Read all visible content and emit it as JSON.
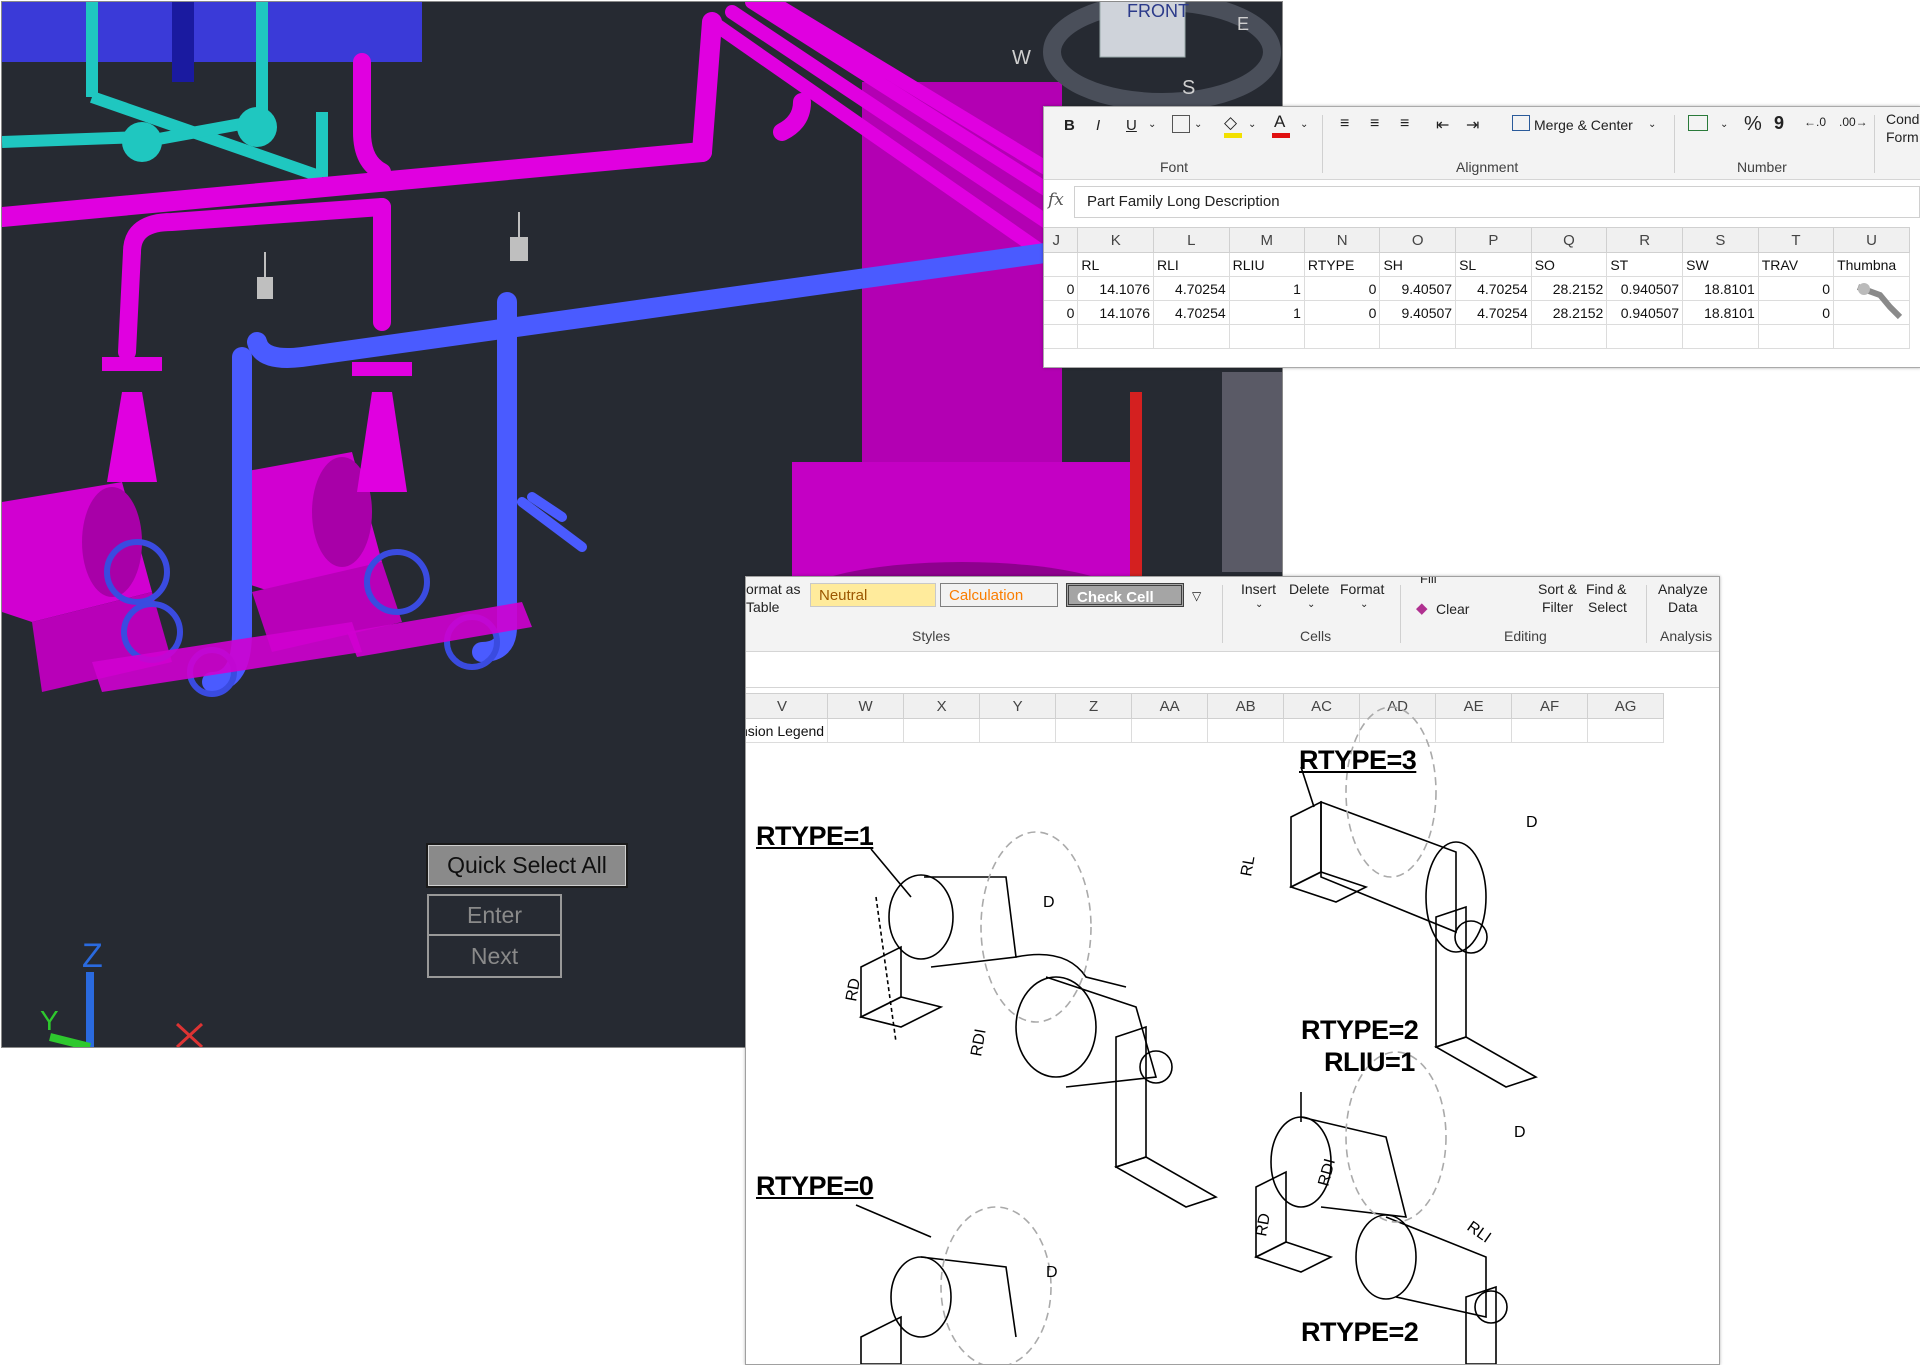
{
  "cad": {
    "view_cube": {
      "face": "FRONT",
      "compass_w": "W",
      "compass_s": "S",
      "compass_e": "E"
    },
    "ucs": {
      "z": "Z",
      "y": "Y"
    },
    "quick_select_button": "Quick Select All",
    "context_menu": [
      "Enter",
      "Next"
    ],
    "colors": {
      "background": "#262a32",
      "pipe": "#e000e0",
      "selected": "#4a5bff",
      "cyan": "#1fc7c0"
    }
  },
  "excel_top": {
    "ribbon": {
      "font_buttons": [
        "B",
        "I",
        "U"
      ],
      "merge_center": "Merge & Center",
      "percent": "%",
      "comma": "9",
      "conditional_1": "Cond",
      "conditional_2": "Form",
      "groups": {
        "font": "Font",
        "alignment": "Alignment",
        "number": "Number"
      }
    },
    "formula_bar": {
      "fx": "fx",
      "value": "Part Family Long Description"
    },
    "column_headers": [
      "J",
      "K",
      "L",
      "M",
      "N",
      "O",
      "P",
      "Q",
      "R",
      "S",
      "T",
      "U"
    ],
    "field_row": [
      "",
      "RL",
      "RLI",
      "RLIU",
      "RTYPE",
      "SH",
      "SL",
      "SO",
      "ST",
      "SW",
      "TRAV",
      "Thumbna"
    ],
    "rows": [
      [
        "0",
        "14.1076",
        "4.70254",
        "1",
        "0",
        "9.40507",
        "4.70254",
        "28.2152",
        "0.940507",
        "18.8101",
        "0",
        ""
      ],
      [
        "0",
        "14.1076",
        "4.70254",
        "1",
        "0",
        "9.40507",
        "4.70254",
        "28.2152",
        "0.940507",
        "18.8101",
        "0",
        ""
      ]
    ]
  },
  "excel_bottom": {
    "ribbon": {
      "format_as_1": "ormat as",
      "format_as_2": "Table",
      "styles": {
        "neutral": "Neutral",
        "calculation": "Calculation",
        "check_cell": "Check Cell"
      },
      "cells": {
        "insert": "Insert",
        "delete": "Delete",
        "format": "Format"
      },
      "editing": {
        "fill": "Fill",
        "clear": "Clear",
        "sort_1": "Sort &",
        "sort_2": "Filter",
        "find_1": "Find &",
        "find_2": "Select"
      },
      "analysis": {
        "analyze_1": "Analyze",
        "analyze_2": "Data"
      },
      "groups": {
        "styles": "Styles",
        "cells": "Cells",
        "editing": "Editing",
        "analysis": "Analysis"
      }
    },
    "column_headers": [
      "V",
      "W",
      "X",
      "Y",
      "Z",
      "AA",
      "AB",
      "AC",
      "AD",
      "AE",
      "AF",
      "AG"
    ],
    "cell_text": "nsion Legend",
    "drawing_labels": {
      "rtype1": "RTYPE=1",
      "rtype3": "RTYPE=3",
      "rtype2": "RTYPE=2",
      "rliu1": "RLIU=1",
      "rtype0": "RTYPE=0",
      "rtype2b": "RTYPE=2",
      "dim_d": "D",
      "dim_rd": "RD",
      "dim_rdi": "RDI",
      "dim_rli": "RLI",
      "dim_rl": "RL"
    }
  }
}
